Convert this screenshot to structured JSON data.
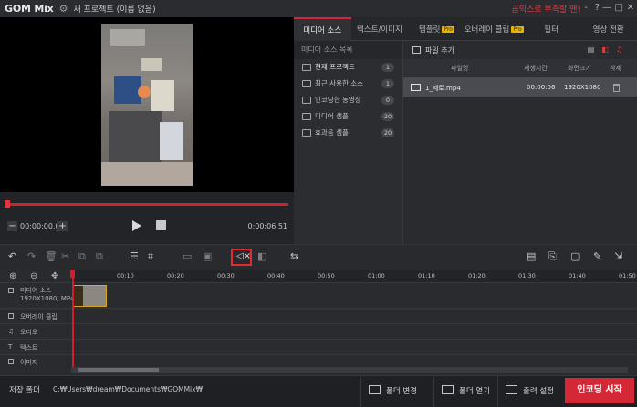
{
  "app": {
    "logo": "GOM Mix",
    "doc_title": "새 프로젝트 (이름 없음)",
    "promo": "곰믹스로 부족할 땐!",
    "window_buttons": [
      "-",
      "?",
      "—",
      "□",
      "✕"
    ]
  },
  "preview": {
    "current_time": "00:00:00.07",
    "duration": "0:00:06.51",
    "progress_fraction": 0.01
  },
  "tabs": [
    {
      "label": "미디어 소스",
      "active": true,
      "pro": false
    },
    {
      "label": "텍스트/이미지",
      "active": false,
      "pro": false
    },
    {
      "label": "템플릿",
      "active": false,
      "pro": true
    },
    {
      "label": "오버레이 클립",
      "active": false,
      "pro": true
    },
    {
      "label": "필터",
      "active": false,
      "pro": false
    },
    {
      "label": "영상 전환",
      "active": false,
      "pro": false
    }
  ],
  "pro_badge": "Pro",
  "source_list": {
    "header": "미디어 소스 목록",
    "items": [
      {
        "label": "현재 프로젝트",
        "count": "1"
      },
      {
        "label": "최근 사용한 소스",
        "count": "1"
      },
      {
        "label": "인코딩한 동영상",
        "count": "0"
      },
      {
        "label": "미디어 샘플",
        "count": "20"
      },
      {
        "label": "효과음 샘플",
        "count": "20"
      }
    ]
  },
  "files": {
    "add_label": "파일 추가",
    "columns": {
      "name": "파일명",
      "duration": "재생시간",
      "size": "화면크기",
      "delete": "삭제"
    },
    "rows": [
      {
        "name": "1_제로.mp4",
        "duration": "00:00:06",
        "size": "1920X1080"
      }
    ]
  },
  "timeline": {
    "ticks": [
      "00:10",
      "00:20",
      "00:30",
      "00:40",
      "00:50",
      "01:00",
      "01:10",
      "01:20",
      "01:30",
      "01:40",
      "01:50"
    ],
    "tracks": [
      {
        "label": "미디어 소스",
        "sub": "1920X1080, MP4"
      },
      {
        "label": "오버레이 클립"
      },
      {
        "label": "오디오"
      },
      {
        "label": "텍스트"
      },
      {
        "label": "이미지"
      }
    ]
  },
  "bottom": {
    "save_label": "저장 폴더",
    "save_path": "C:₩Users₩dream₩Documents₩GOMMix₩",
    "change_folder": "폴더 변경",
    "open_folder": "폴더 열기",
    "output_settings": "출력 설정",
    "encode": "인코딩 시작"
  },
  "colors": {
    "accent": "#d52836",
    "pro": "#e8b600"
  }
}
